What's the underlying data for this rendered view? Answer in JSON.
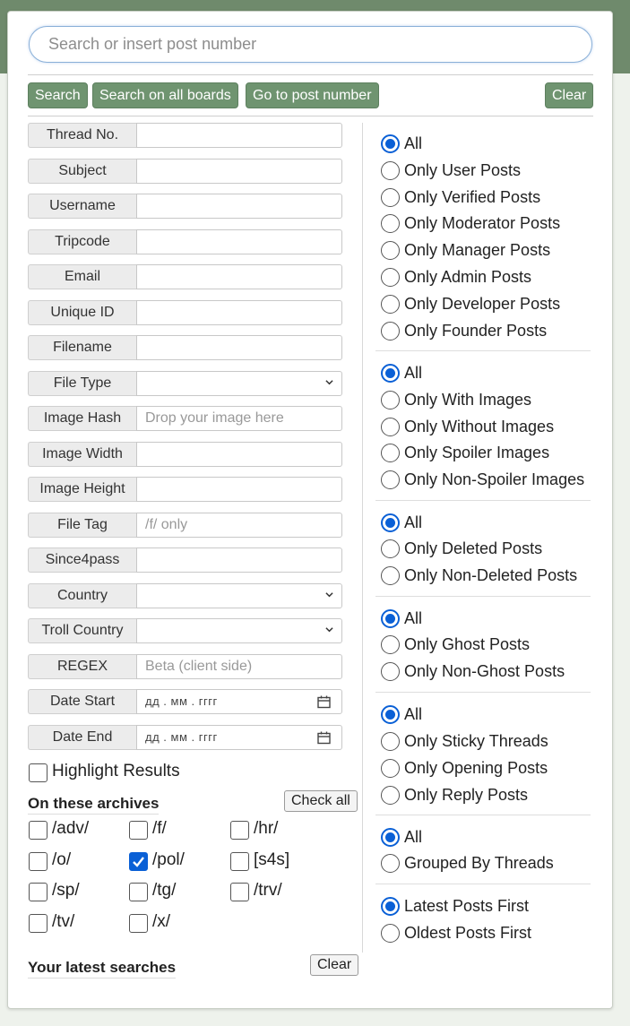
{
  "search": {
    "placeholder": "Search or insert post number"
  },
  "buttons": {
    "search": "Search",
    "search_all": "Search on all boards",
    "go_to_post": "Go to post number",
    "clear": "Clear"
  },
  "fields": {
    "thread_no": {
      "label": "Thread No."
    },
    "subject": {
      "label": "Subject"
    },
    "username": {
      "label": "Username"
    },
    "tripcode": {
      "label": "Tripcode"
    },
    "email": {
      "label": "Email"
    },
    "unique_id": {
      "label": "Unique ID"
    },
    "filename": {
      "label": "Filename"
    },
    "file_type": {
      "label": "File Type"
    },
    "image_hash": {
      "label": "Image Hash",
      "placeholder": "Drop your image here"
    },
    "image_width": {
      "label": "Image Width"
    },
    "image_height": {
      "label": "Image Height"
    },
    "file_tag": {
      "label": "File Tag",
      "placeholder": "/f/ only"
    },
    "since4pass": {
      "label": "Since4pass"
    },
    "country": {
      "label": "Country"
    },
    "troll_country": {
      "label": "Troll Country"
    },
    "regex": {
      "label": "REGEX",
      "placeholder": "Beta (client side)"
    },
    "date_start": {
      "label": "Date Start",
      "placeholder": "дд . мм . гггг"
    },
    "date_end": {
      "label": "Date End",
      "placeholder": "дд . мм . гггг"
    }
  },
  "highlight": {
    "label": "Highlight Results",
    "checked": false
  },
  "archives": {
    "title": "On these archives",
    "check_all": "Check all",
    "boards": [
      {
        "label": "/adv/",
        "checked": false
      },
      {
        "label": "/f/",
        "checked": false
      },
      {
        "label": "/hr/",
        "checked": false
      },
      {
        "label": "/o/",
        "checked": false
      },
      {
        "label": "/pol/",
        "checked": true
      },
      {
        "label": "[s4s]",
        "checked": false
      },
      {
        "label": "/sp/",
        "checked": false
      },
      {
        "label": "/tg/",
        "checked": false
      },
      {
        "label": "/trv/",
        "checked": false
      },
      {
        "label": "/tv/",
        "checked": false
      },
      {
        "label": "/x/",
        "checked": false
      }
    ]
  },
  "latest_searches": {
    "title": "Your latest searches",
    "clear": "Clear"
  },
  "filters": [
    {
      "selected": 0,
      "options": [
        "All",
        "Only User Posts",
        "Only Verified Posts",
        "Only Moderator Posts",
        "Only Manager Posts",
        "Only Admin Posts",
        "Only Developer Posts",
        "Only Founder Posts"
      ]
    },
    {
      "selected": 0,
      "options": [
        "All",
        "Only With Images",
        "Only Without Images",
        "Only Spoiler Images",
        "Only Non-Spoiler Images"
      ]
    },
    {
      "selected": 0,
      "options": [
        "All",
        "Only Deleted Posts",
        "Only Non-Deleted Posts"
      ]
    },
    {
      "selected": 0,
      "options": [
        "All",
        "Only Ghost Posts",
        "Only Non-Ghost Posts"
      ]
    },
    {
      "selected": 0,
      "options": [
        "All",
        "Only Sticky Threads",
        "Only Opening Posts",
        "Only Reply Posts"
      ]
    },
    {
      "selected": 0,
      "options": [
        "All",
        "Grouped By Threads"
      ]
    },
    {
      "selected": 0,
      "options": [
        "Latest Posts First",
        "Oldest Posts First"
      ]
    }
  ],
  "colors": {
    "accent": "#0a60d6",
    "button_green": "#6f9470",
    "header_green": "#6f8a6c"
  }
}
